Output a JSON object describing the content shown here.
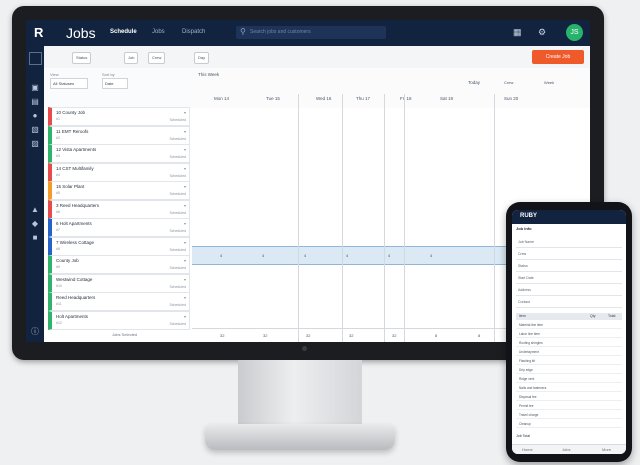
{
  "app": {
    "logo": "R",
    "title": "Jobs",
    "tabs": [
      "Schedule",
      "Jobs",
      "Dispatch"
    ],
    "search_placeholder": "Search jobs and customers",
    "avatar_initials": "JS"
  },
  "toolbar": {
    "chips": [
      "Status",
      "Job",
      "Crew",
      "Day"
    ],
    "create_label": "Create Job"
  },
  "filters": {
    "view_label": "View",
    "view_value": "All Statuses",
    "sort_label": "Sort by",
    "sort_value": "Date"
  },
  "jobs": [
    {
      "title": "10 County Job",
      "sub": "#1",
      "meta": "Scheduled",
      "color": "#e74c4c"
    },
    {
      "title": "11 EMT Reroofs",
      "sub": "#2",
      "meta": "Scheduled",
      "color": "#2fb36d"
    },
    {
      "title": "12 Vista Apartments",
      "sub": "#3",
      "meta": "Scheduled",
      "color": "#2fb36d"
    },
    {
      "title": "14 CST Multifamily",
      "sub": "#4",
      "meta": "Scheduled",
      "color": "#e74c4c"
    },
    {
      "title": "15 Solar Plant",
      "sub": "#5",
      "meta": "Scheduled",
      "color": "#f39c2a"
    },
    {
      "title": "3 Reed Headquarters",
      "sub": "#6",
      "meta": "Scheduled",
      "color": "#e74c4c"
    },
    {
      "title": "6 Holt Apartments",
      "sub": "#7",
      "meta": "Scheduled",
      "color": "#2463c7"
    },
    {
      "title": "7 Wireless Cottage",
      "sub": "#8",
      "meta": "Scheduled",
      "color": "#2463c7"
    },
    {
      "title": "County Job",
      "sub": "#9",
      "meta": "Scheduled",
      "color": "#2fb36d"
    },
    {
      "title": "Westwind Cottage",
      "sub": "#10",
      "meta": "Scheduled",
      "color": "#2fb36d"
    },
    {
      "title": "Reed Headquarters",
      "sub": "#11",
      "meta": "Scheduled",
      "color": "#2fb36d"
    },
    {
      "title": "Holt Apartments",
      "sub": "#12",
      "meta": "Scheduled",
      "color": "#2fb36d"
    }
  ],
  "list_footer": "Jobs Selected",
  "calendar": {
    "range": "This Week",
    "today_label": "Today",
    "crew_label": "Crew",
    "view_value": "Week",
    "days": [
      "Mon 14",
      "Tue 15",
      "Wed 16",
      "Thu 17",
      "Fri 18",
      "Sat 19",
      "Sun 20"
    ],
    "band_values": [
      "4",
      "4",
      "4",
      "4",
      "4",
      "4"
    ],
    "footer_values": [
      "32",
      "32",
      "32",
      "32",
      "32",
      "8",
      "8",
      "16"
    ]
  },
  "phone": {
    "title": "RUBY",
    "section": "Job Info",
    "fields": [
      "Job Name",
      "Crew",
      "Status",
      "Start Date",
      "Address",
      "Contact"
    ],
    "table_headers": [
      "Item",
      "Qty",
      "Total"
    ],
    "rows": [
      "Material line item",
      "Labor line item",
      "Roofing shingles",
      "Underlayment",
      "Flashing kit",
      "Drip edge",
      "Ridge vent",
      "Nails and fasteners",
      "Disposal fee",
      "Permit fee",
      "Travel charge",
      "Cleanup"
    ],
    "footer_label": "Job Total",
    "nav": [
      "Home",
      "Jobs",
      "More"
    ]
  }
}
